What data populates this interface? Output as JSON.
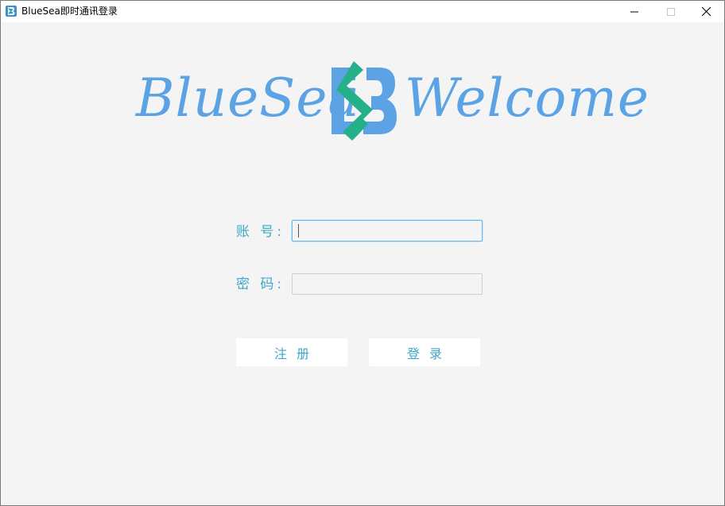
{
  "window": {
    "title": "BlueSea即时通讯登录",
    "icon": "bluesea-app-icon",
    "controls": [
      "minimize-icon",
      "maximize-icon",
      "close-icon"
    ]
  },
  "logo": {
    "left_text": "BlueSea",
    "right_text": "Welcome",
    "mark": "bluesea-b-logo-icon"
  },
  "form": {
    "account_label": "账 号:",
    "account_value": "",
    "password_label": "密 码:",
    "password_value": ""
  },
  "buttons": {
    "register_label": "注册",
    "login_label": "登录"
  },
  "colors": {
    "brand_blue": "#5ba3e4",
    "brand_green": "#25b08a",
    "label_cyan": "#3fa7c9",
    "focus_border": "#6cb6e8",
    "background": "#f4f4f4"
  }
}
